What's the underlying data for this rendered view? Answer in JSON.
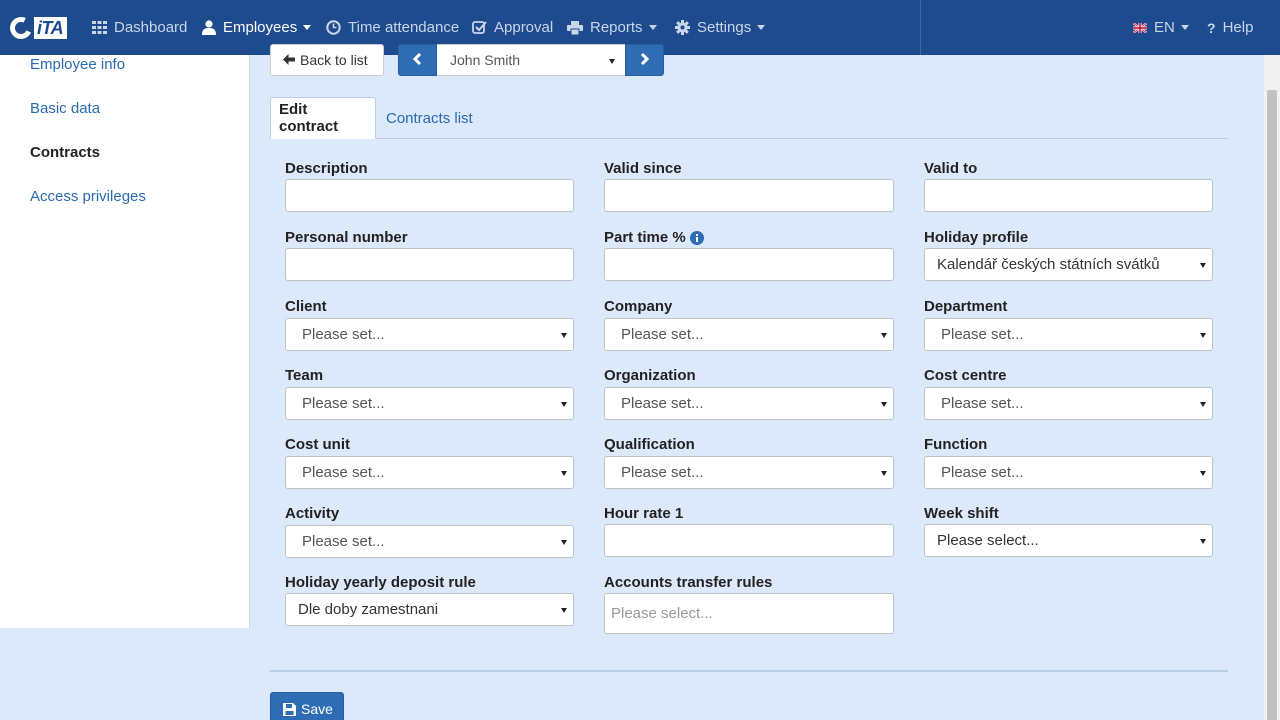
{
  "brand": {
    "logo_text": "iTA"
  },
  "navbar": {
    "items": [
      {
        "label": "Dashboard",
        "icon": "grid-icon"
      },
      {
        "label": "Employees",
        "icon": "user-icon",
        "active": true,
        "dropdown": true
      },
      {
        "label": "Time attendance",
        "icon": "clock-icon"
      },
      {
        "label": "Approval",
        "icon": "check-icon"
      },
      {
        "label": "Reports",
        "icon": "printer-icon",
        "dropdown": true
      },
      {
        "label": "Settings",
        "icon": "gear-icon",
        "dropdown": true
      }
    ],
    "language": "EN",
    "language_icon": "uk-flag-icon",
    "help": "Help",
    "help_icon": "question-icon"
  },
  "sidebar": {
    "items": [
      {
        "label": "Employee info"
      },
      {
        "label": "Basic data"
      },
      {
        "label": "Contracts",
        "active": true
      },
      {
        "label": "Access privileges"
      }
    ]
  },
  "toolbar": {
    "back_label": "Back to list",
    "employee": "John Smith",
    "prev_icon": "chevron-left-icon",
    "next_icon": "chevron-right-icon"
  },
  "tabs": [
    {
      "label": "Edit contract",
      "active": true
    },
    {
      "label": "Contracts list"
    }
  ],
  "form": {
    "description": {
      "label": "Description",
      "value": ""
    },
    "valid_since": {
      "label": "Valid since",
      "value": ""
    },
    "valid_to": {
      "label": "Valid to",
      "value": ""
    },
    "personal_number": {
      "label": "Personal number",
      "value": ""
    },
    "part_time": {
      "label": "Part time %",
      "value": ""
    },
    "holiday_profile": {
      "label": "Holiday profile",
      "value": "Kalendář českých státních svátků"
    },
    "client": {
      "label": "Client",
      "value": "Please set..."
    },
    "company": {
      "label": "Company",
      "value": "Please set..."
    },
    "department": {
      "label": "Department",
      "value": "Please set..."
    },
    "team": {
      "label": "Team",
      "value": "Please set..."
    },
    "organization": {
      "label": "Organization",
      "value": "Please set..."
    },
    "cost_centre": {
      "label": "Cost centre",
      "value": "Please set..."
    },
    "cost_unit": {
      "label": "Cost unit",
      "value": "Please set..."
    },
    "qualification": {
      "label": "Qualification",
      "value": "Please set..."
    },
    "function": {
      "label": "Function",
      "value": "Please set..."
    },
    "activity": {
      "label": "Activity",
      "value": "Please set..."
    },
    "hour_rate": {
      "label": "Hour rate 1",
      "value": ""
    },
    "week_shift": {
      "label": "Week shift",
      "value": "Please select..."
    },
    "holiday_deposit": {
      "label": "Holiday yearly deposit rule",
      "value": "Dle doby zamestnani"
    },
    "accounts_transfer": {
      "label": "Accounts transfer rules",
      "placeholder": "Please select..."
    }
  },
  "save_label": "Save",
  "colors": {
    "navbar": "#1e4b8e",
    "accent": "#2e6db4",
    "background": "#dce9fb",
    "link": "#2a6ab0"
  }
}
